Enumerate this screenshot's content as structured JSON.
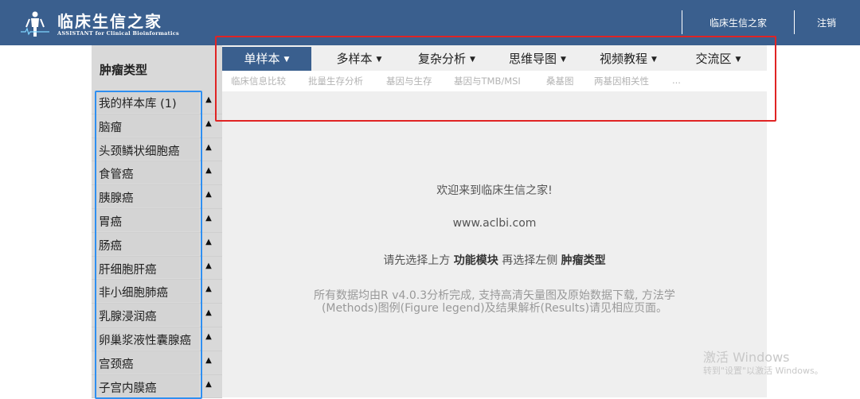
{
  "header": {
    "brand_cn": "临床生信之家",
    "brand_en": "ASSISTANT for Clinical Bioinformatics",
    "links": [
      "临床生信之家",
      "注销"
    ]
  },
  "sidebar": {
    "title": "肿瘤类型",
    "items": [
      {
        "label": "我的样本库 (1)"
      },
      {
        "label": "脑瘤"
      },
      {
        "label": "头颈鳞状细胞癌"
      },
      {
        "label": "食管癌"
      },
      {
        "label": "胰腺癌"
      },
      {
        "label": "胃癌"
      },
      {
        "label": "肠癌"
      },
      {
        "label": "肝细胞肝癌"
      },
      {
        "label": "非小细胞肺癌"
      },
      {
        "label": "乳腺浸润癌"
      },
      {
        "label": "卵巢浆液性囊腺癌"
      },
      {
        "label": "宫颈癌"
      },
      {
        "label": "子宫内膜癌"
      }
    ],
    "caret_glyph": "▲"
  },
  "nav": {
    "tabs": [
      {
        "label": "单样本"
      },
      {
        "label": "多样本"
      },
      {
        "label": "复杂分析"
      },
      {
        "label": "思维导图"
      },
      {
        "label": "视频教程"
      },
      {
        "label": "交流区"
      }
    ],
    "dropdown_glyph": "▼",
    "subtabs": [
      "临床信息比较",
      "批量生存分析",
      "基因与生存",
      "基因与TMB/MSI",
      "桑基图",
      "两基因相关性",
      "..."
    ]
  },
  "welcome": {
    "line1": "欢迎来到临床生信之家!",
    "line2": "www.aclbi.com",
    "line3_prefix": "请先选择上方 ",
    "line3_bold1": "功能模块",
    "line3_mid": " 再选择左侧 ",
    "line3_bold2": "肿瘤类型",
    "line4a": "所有数据均由R v4.0.3分析完成, 支持高清矢量图及原始数据下载, 方法学",
    "line4b": "(Methods)图例(Figure legend)及结果解析(Results)请见相应页面。"
  },
  "watermark": {
    "line1": "激活 Windows",
    "line2": "转到\"设置\"以激活 Windows。"
  },
  "colors": {
    "header_bg": "#3a5f8e",
    "active_tab": "#3a5f8e",
    "highlight_red": "#e02424",
    "highlight_blue": "#2f8ff0"
  }
}
